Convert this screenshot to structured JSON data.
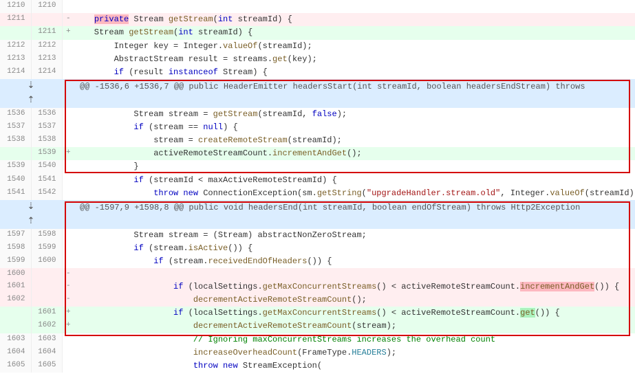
{
  "hunks": {
    "h1": "@@ -1536,6 +1536,7 @@ public HeaderEmitter headersStart(int streamId, boolean headersEndStream) throws",
    "h2": "@@ -1597,9 +1598,8 @@ public void headersEnd(int streamId, boolean endOfStream) throws Http2Exception"
  },
  "ln": {
    "r0l": "1210",
    "r0r": "1210",
    "r1l": "1211",
    "r1r": "",
    "r2l": "",
    "r2r": "1211",
    "r3l": "1212",
    "r3r": "1212",
    "r4l": "1213",
    "r4r": "1213",
    "r5l": "1214",
    "r5r": "1214",
    "r6l": "1536",
    "r6r": "1536",
    "r7l": "1537",
    "r7r": "1537",
    "r8l": "1538",
    "r8r": "1538",
    "r9l": "",
    "r9r": "1539",
    "r10l": "1539",
    "r10r": "1540",
    "r11l": "1540",
    "r11r": "1541",
    "r12l": "1541",
    "r12r": "1542",
    "r13l": "1597",
    "r13r": "1598",
    "r14l": "1598",
    "r14r": "1599",
    "r15l": "1599",
    "r15r": "1600",
    "r16l": "1600",
    "r16r": "",
    "r17l": "1601",
    "r17r": "",
    "r18l": "1602",
    "r18r": "",
    "r19l": "",
    "r19r": "1601",
    "r20l": "",
    "r20r": "1602",
    "r21l": "1603",
    "r21r": "1603",
    "r22l": "1604",
    "r22r": "1604",
    "r23l": "1605",
    "r23r": "1605"
  },
  "t": {
    "r1_a": "    ",
    "r1_b": "private",
    "r1_c": " Stream ",
    "r1_d": "getStream",
    "r1_e": "(",
    "r1_f": "int",
    "r1_g": " streamId) {",
    "r2_a": "    Stream ",
    "r2_b": "getStream",
    "r2_c": "(",
    "r2_d": "int",
    "r2_e": " streamId) {",
    "r3_a": "        Integer key = Integer.",
    "r3_b": "valueOf",
    "r3_c": "(streamId);",
    "r4_a": "        AbstractStream result = streams.",
    "r4_b": "get",
    "r4_c": "(key);",
    "r5_a": "        ",
    "r5_b": "if",
    "r5_c": " (result ",
    "r5_d": "instanceof",
    "r5_e": " Stream) {",
    "r6_a": "            Stream stream = ",
    "r6_b": "getStream",
    "r6_c": "(streamId, ",
    "r6_d": "false",
    "r6_e": ");",
    "r7_a": "            ",
    "r7_b": "if",
    "r7_c": " (stream == ",
    "r7_d": "null",
    "r7_e": ") {",
    "r8_a": "                stream = ",
    "r8_b": "createRemoteStream",
    "r8_c": "(streamId);",
    "r9_a": "                activeRemoteStreamCount.",
    "r9_b": "incrementAndGet",
    "r9_c": "();",
    "r10_a": "            }",
    "r11_a": "            ",
    "r11_b": "if",
    "r11_c": " (streamId < maxActiveRemoteStreamId) {",
    "r12_a": "                ",
    "r12_b": "throw new",
    "r12_c": " ConnectionException(sm.",
    "r12_d": "getString",
    "r12_e": "(",
    "r12_f": "\"upgradeHandler.stream.old\"",
    "r12_g": ", Integer.",
    "r12_h": "valueOf",
    "r12_i": "(streamId),",
    "r13_a": "            Stream stream = (Stream) abstractNonZeroStream;",
    "r14_a": "            ",
    "r14_b": "if",
    "r14_c": " (stream.",
    "r14_d": "isActive",
    "r14_e": "()) {",
    "r15_a": "                ",
    "r15_b": "if",
    "r15_c": " (stream.",
    "r15_d": "receivedEndOfHeaders",
    "r15_e": "()) {",
    "r16_a": "",
    "r17_a": "                    ",
    "r17_b": "if",
    "r17_c": " (localSettings.",
    "r17_d": "getMaxConcurrentStreams",
    "r17_e": "() < activeRemoteStreamCount.",
    "r17_f": "incrementAndGet",
    "r17_g": "()) {",
    "r18_a": "                        ",
    "r18_b": "decrementActiveRemoteStreamCount",
    "r18_c": "();",
    "r19_a": "                    ",
    "r19_b": "if",
    "r19_c": " (localSettings.",
    "r19_d": "getMaxConcurrentStreams",
    "r19_e": "() < activeRemoteStreamCount.",
    "r19_f": "get",
    "r19_g": "()) {",
    "r20_a": "                        ",
    "r20_b": "decrementActiveRemoteStreamCount",
    "r20_c": "(stream);",
    "r21_a": "                        ",
    "r21_b": "// Ignoring maxConcurrentStreams increases the overhead count",
    "r22_a": "                        ",
    "r22_b": "increaseOverheadCount",
    "r22_c": "(FrameType.",
    "r22_d": "HEADERS",
    "r22_e": ");",
    "r23_a": "                        ",
    "r23_b": "throw new",
    "r23_c": " StreamException("
  },
  "marks": {
    "plus": "+",
    "minus": "-"
  },
  "expand": {
    "down": "⋮↓",
    "up": "⋮↑"
  }
}
